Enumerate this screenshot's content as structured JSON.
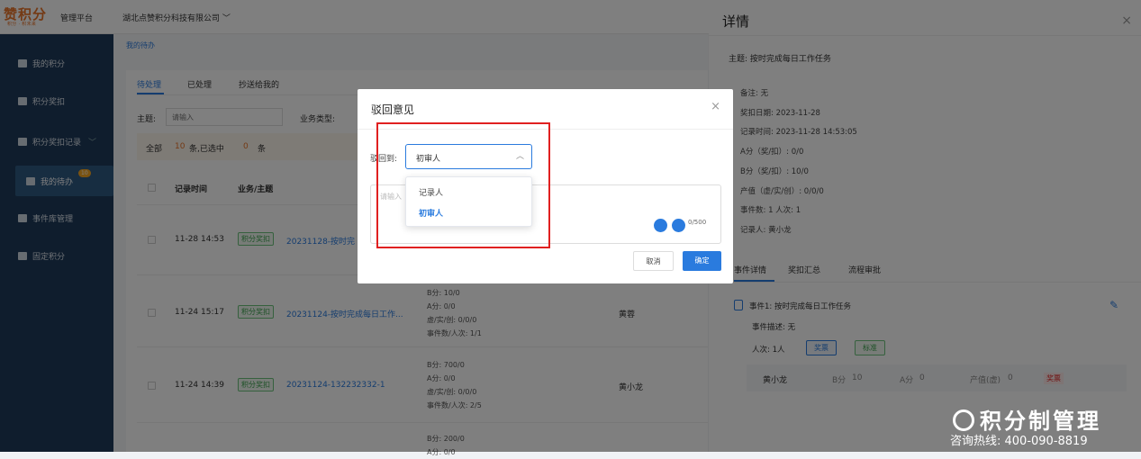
{
  "header": {
    "logo": "赞积分",
    "logo_sub": "积分 · 积未来",
    "platform": "管理平台",
    "company": "湖北点赞积分科技有限公司"
  },
  "sidebar": {
    "items": [
      {
        "label": "我的积分"
      },
      {
        "label": "积分奖扣"
      },
      {
        "label": "积分奖扣记录"
      },
      {
        "label": "我的待办",
        "badge": "10"
      },
      {
        "label": "事件库管理"
      },
      {
        "label": "固定积分"
      }
    ]
  },
  "main": {
    "breadcrumb": "我的待办",
    "tabs": [
      "待处理",
      "已处理",
      "抄送给我的"
    ],
    "filter": {
      "subject_label": "主题:",
      "subject_placeholder": "请输入",
      "biz_label": "业务类型:"
    },
    "summary": {
      "all": "全部",
      "count": "10",
      "mid": "条,已选中",
      "selected": "0",
      "unit": "条"
    },
    "columns": [
      "记录时间",
      "业务/主题"
    ],
    "rows": [
      {
        "time": "11-28 14:53",
        "tag": "积分奖扣",
        "subject": "20231128-按时完",
        "stats": [],
        "person": ""
      },
      {
        "time": "11-24 15:17",
        "tag": "积分奖扣",
        "subject": "20231124-按时完成每日工作...",
        "stats": [
          "B分: 10/0",
          "A分: 0/0",
          "虚/实/创: 0/0/0",
          "事件数/人次: 1/1"
        ],
        "person": "黄蓉"
      },
      {
        "time": "11-24 14:39",
        "tag": "积分奖扣",
        "subject": "20231124-132232332-1",
        "stats": [
          "B分: 700/0",
          "A分: 0/0",
          "虚/实/创: 0/0/0",
          "事件数/人次: 2/5"
        ],
        "person": "黄小龙"
      },
      {
        "time": "",
        "tag": "",
        "subject": "",
        "stats": [
          "B分: 200/0",
          "A分: 0/0"
        ],
        "person": ""
      }
    ]
  },
  "drawer": {
    "title": "详情",
    "close": "×",
    "subject": "主题: 按时完成每日工作任务",
    "info": [
      "备注: 无",
      "奖扣日期: 2023-11-28",
      "记录时间: 2023-11-28 14:53:05",
      "A分（奖/扣）: 0/0",
      "B分（奖/扣）: 10/0",
      "产值（虚/实/创）: 0/0/0",
      "事件数: 1    人次: 1",
      "记录人: 黄小龙"
    ],
    "tabs": [
      "事件详情",
      "奖扣汇总",
      "流程审批"
    ],
    "event": {
      "title": "事件1: 按时完成每日工作任务",
      "desc": "事件描述: 无",
      "count": "人次: 1人",
      "tag1": "奖票",
      "tag2": "标准"
    },
    "person": {
      "name": "黄小龙",
      "b_label": "B分",
      "b": "10",
      "a_label": "A分",
      "a": "0",
      "v_label": "产值(虚)",
      "v": "0",
      "status": "奖票"
    }
  },
  "modal": {
    "title": "驳回意见",
    "close": "×",
    "reject_label": "驳回到:",
    "selected": "初审人",
    "options": [
      "记录人",
      "初审人"
    ],
    "textarea_placeholder": "请输入",
    "counter": "0/500",
    "cancel": "取消",
    "confirm": "确定"
  },
  "watermark": {
    "brand": "积分制管理",
    "hotline": "咨询热线: 400-090-8819"
  },
  "colors": {
    "accent": "#2a7bde",
    "brand": "#e8742a",
    "sidebar": "#1f3a5a",
    "highlight": "#e02020"
  }
}
